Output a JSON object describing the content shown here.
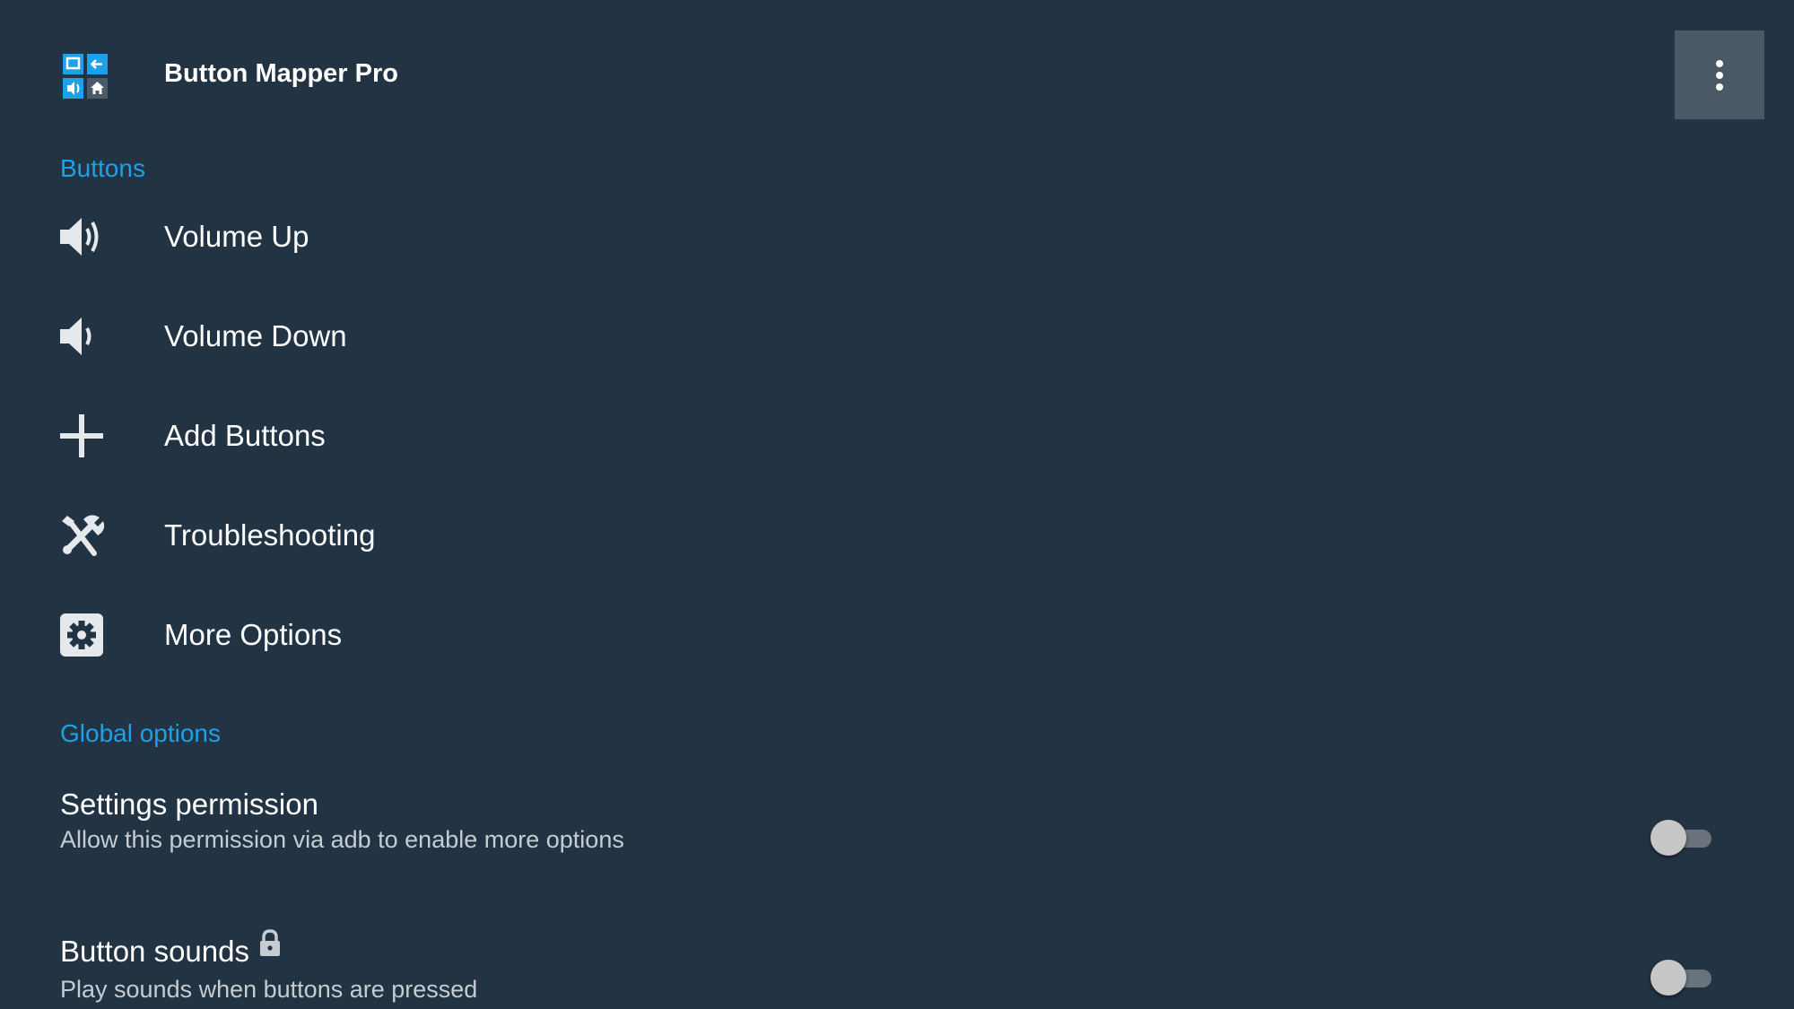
{
  "app": {
    "title": "Button Mapper Pro",
    "icon": "button-mapper-app-icon"
  },
  "toolbar": {
    "overflow_icon": "more-vert-icon"
  },
  "sections": {
    "buttons_header": "Buttons",
    "global_header": "Global options"
  },
  "buttons": {
    "items": [
      {
        "label": "Volume Up",
        "icon": "volume-up-icon"
      },
      {
        "label": "Volume Down",
        "icon": "volume-down-icon"
      },
      {
        "label": "Add Buttons",
        "icon": "plus-icon"
      },
      {
        "label": "Troubleshooting",
        "icon": "tools-icon"
      },
      {
        "label": "More Options",
        "icon": "gear-icon"
      }
    ]
  },
  "global_options": {
    "settings_permission": {
      "title": "Settings permission",
      "summary": "Allow this permission via adb to enable more options",
      "enabled": false
    },
    "button_sounds": {
      "title": "Button sounds",
      "summary": "Play sounds when buttons are pressed",
      "locked": true,
      "enabled": false
    }
  },
  "colors": {
    "background": "#223343",
    "accent": "#1ea1e6",
    "overflow_button": "#4a5965",
    "icon": "#e6e9ec"
  }
}
